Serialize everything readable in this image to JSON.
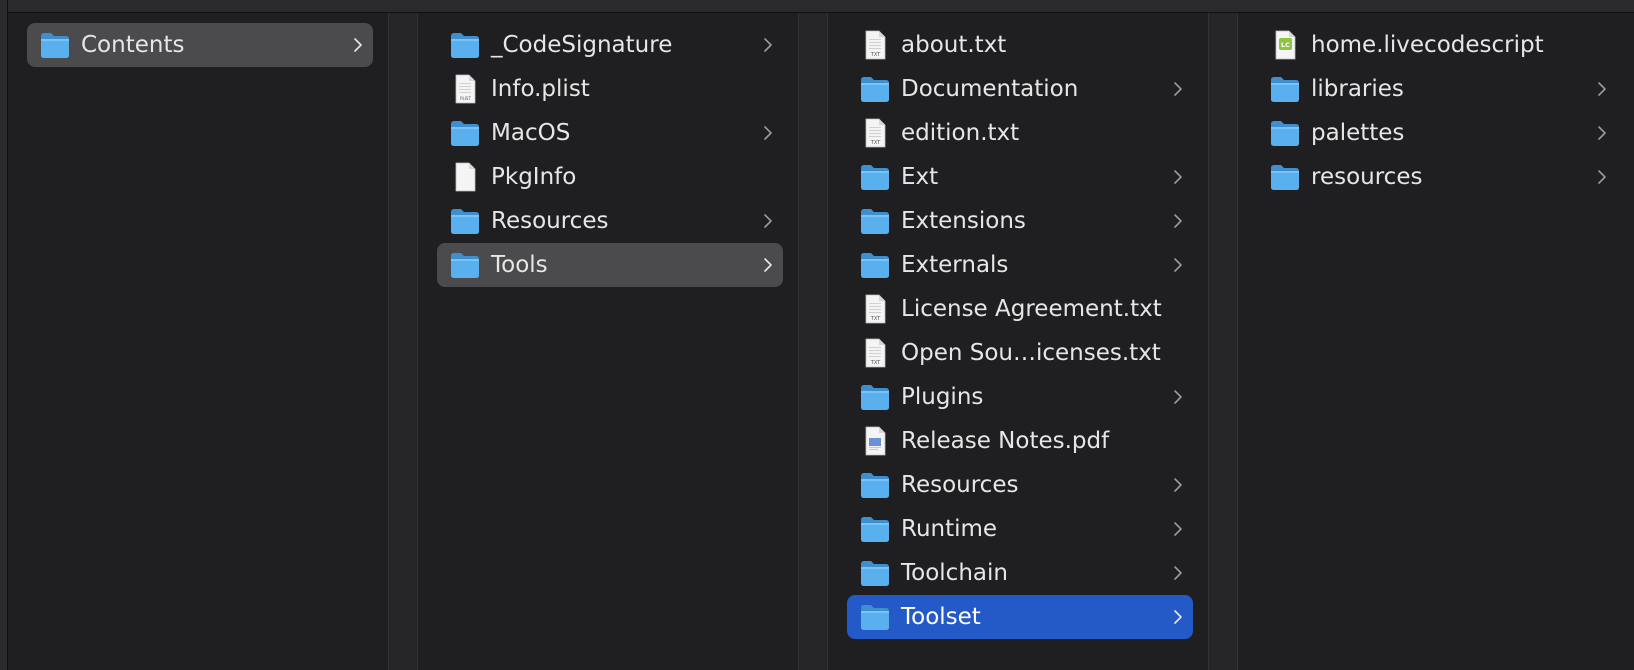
{
  "columns": [
    {
      "items": [
        {
          "label": "Contents",
          "kind": "folder",
          "chevron": true,
          "selected": "gray"
        }
      ]
    },
    {
      "items": [
        {
          "label": "_CodeSignature",
          "kind": "folder",
          "chevron": true
        },
        {
          "label": "Info.plist",
          "kind": "plist",
          "chevron": false
        },
        {
          "label": "MacOS",
          "kind": "folder",
          "chevron": true
        },
        {
          "label": "PkgInfo",
          "kind": "blank",
          "chevron": false
        },
        {
          "label": "Resources",
          "kind": "folder",
          "chevron": true
        },
        {
          "label": "Tools",
          "kind": "folder",
          "chevron": true,
          "selected": "gray"
        }
      ]
    },
    {
      "items": [
        {
          "label": "about.txt",
          "kind": "txt",
          "chevron": false
        },
        {
          "label": "Documentation",
          "kind": "folder",
          "chevron": true
        },
        {
          "label": "edition.txt",
          "kind": "txt",
          "chevron": false
        },
        {
          "label": "Ext",
          "kind": "folder",
          "chevron": true
        },
        {
          "label": "Extensions",
          "kind": "folder",
          "chevron": true
        },
        {
          "label": "Externals",
          "kind": "folder",
          "chevron": true
        },
        {
          "label": "License Agreement.txt",
          "kind": "txt",
          "chevron": false
        },
        {
          "label": "Open Sou…icenses.txt",
          "kind": "txt",
          "chevron": false
        },
        {
          "label": "Plugins",
          "kind": "folder",
          "chevron": true
        },
        {
          "label": "Release Notes.pdf",
          "kind": "pdf",
          "chevron": false
        },
        {
          "label": "Resources",
          "kind": "folder",
          "chevron": true
        },
        {
          "label": "Runtime",
          "kind": "folder",
          "chevron": true
        },
        {
          "label": "Toolchain",
          "kind": "folder",
          "chevron": true
        },
        {
          "label": "Toolset",
          "kind": "folder",
          "chevron": true,
          "selected": "blue"
        }
      ]
    },
    {
      "items": [
        {
          "label": "home.livecodescript",
          "kind": "livecode",
          "chevron": false
        },
        {
          "label": "libraries",
          "kind": "folder",
          "chevron": true
        },
        {
          "label": "palettes",
          "kind": "folder",
          "chevron": true
        },
        {
          "label": "resources",
          "kind": "folder",
          "chevron": true
        }
      ]
    }
  ],
  "icon_labels": {
    "txt": "TXT",
    "plist": "PLIST",
    "livecode": "LC"
  },
  "colors": {
    "folder": "#5ab0ef",
    "selection_gray": "#4b4b4d",
    "selection_blue": "#2459c8",
    "text": "#e6e6e6"
  }
}
